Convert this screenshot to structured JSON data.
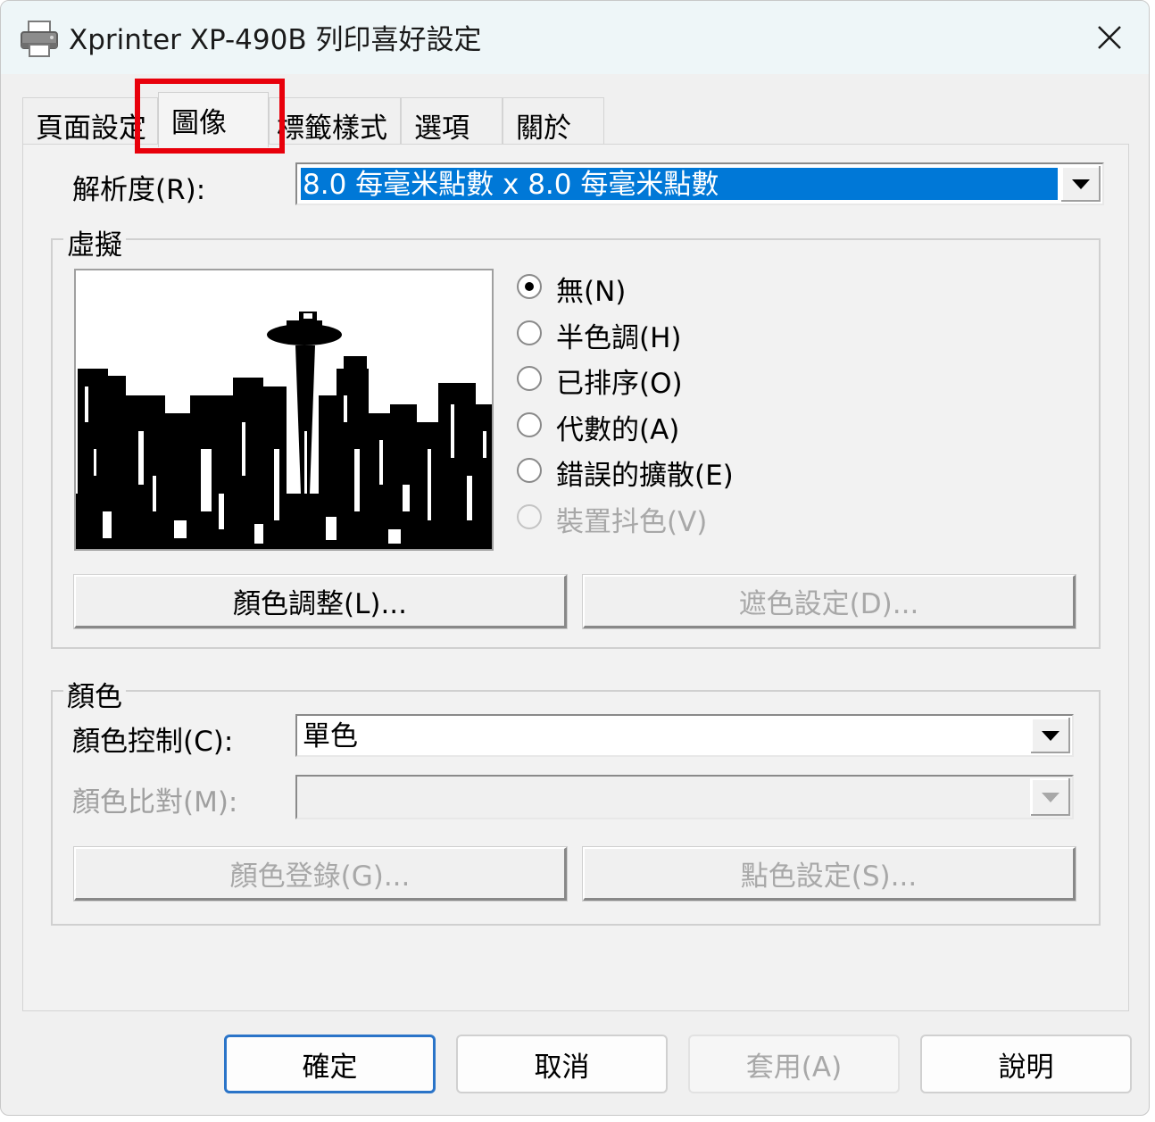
{
  "window": {
    "title": "Xprinter XP-490B 列印喜好設定",
    "icon": "printer-icon",
    "close_icon": "close-icon"
  },
  "tabs": [
    {
      "label": "頁面設定",
      "active": false
    },
    {
      "label": "圖像",
      "active": true
    },
    {
      "label": "標籤樣式",
      "active": false
    },
    {
      "label": "選項",
      "active": false
    },
    {
      "label": "關於",
      "active": false
    }
  ],
  "resolution": {
    "label": "解析度(R):",
    "value": "8.0 每毫米點數 x 8.0 每毫米點數"
  },
  "dithering": {
    "group_title": "虛擬",
    "options": [
      {
        "label": "無(N)",
        "checked": true,
        "enabled": true
      },
      {
        "label": "半色調(H)",
        "checked": false,
        "enabled": true
      },
      {
        "label": "已排序(O)",
        "checked": false,
        "enabled": true
      },
      {
        "label": "代數的(A)",
        "checked": false,
        "enabled": true
      },
      {
        "label": "錯誤的擴散(E)",
        "checked": false,
        "enabled": true
      },
      {
        "label": "裝置抖色(V)",
        "checked": false,
        "enabled": false
      }
    ],
    "color_adjust_button": "顏色調整(L)...",
    "mask_settings_button": "遮色設定(D)..."
  },
  "color": {
    "group_title": "顏色",
    "control_label": "顏色控制(C):",
    "control_value": "單色",
    "matching_label": "顏色比對(M):",
    "matching_value": "",
    "register_button": "顏色登錄(G)...",
    "spot_color_button": "點色設定(S)..."
  },
  "footer": {
    "ok": "確定",
    "cancel": "取消",
    "apply": "套用(A)",
    "help": "說明"
  },
  "colors": {
    "highlight_box": "#e8000b",
    "selection": "#0078d7",
    "default_button_border": "#2a74c8"
  }
}
